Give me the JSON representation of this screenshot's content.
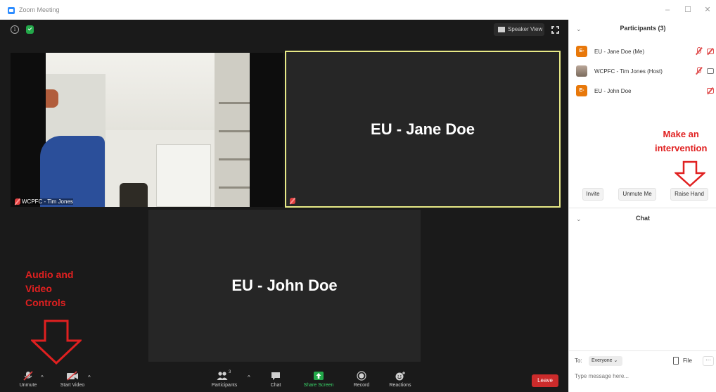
{
  "window": {
    "title": "Zoom Meeting",
    "minimize_icon": "–",
    "maximize_icon": "☐",
    "close_icon": "✕"
  },
  "video": {
    "speaker_view_label": "Speaker View",
    "tiles": {
      "tim": {
        "label": "WCPFC - Tim Jones"
      },
      "jane": {
        "name": "EU - Jane Doe"
      },
      "john": {
        "name": "EU - John Doe"
      }
    }
  },
  "annotations": {
    "controls_line1": "Audio and",
    "controls_line2": "Video",
    "controls_line3": "Controls",
    "intervention_line1": "Make an",
    "intervention_line2": "intervention",
    "color": "#e02020"
  },
  "toolbar": {
    "unmute": "Unmute",
    "start_video": "Start Video",
    "participants": "Participants",
    "participants_count": "3",
    "chat": "Chat",
    "share_screen": "Share Screen",
    "record": "Record",
    "reactions": "Reactions",
    "leave": "Leave",
    "caret": "^"
  },
  "panel": {
    "participants_title": "Participants (3)",
    "collapse_icon": "⌄",
    "participants": [
      {
        "initials": "E-",
        "name": "EU - Jane Doe (Me)"
      },
      {
        "initials": "",
        "name": "WCPFC - Tim Jones (Host)"
      },
      {
        "initials": "E-",
        "name": "EU - John Doe"
      }
    ],
    "invite": "Invite",
    "unmute_me": "Unmute Me",
    "raise_hand": "Raise Hand",
    "chat_title": "Chat",
    "to_label": "To:",
    "recipient": "Everyone ⌄",
    "file": "File",
    "more": "···",
    "message_placeholder": "Type message here..."
  },
  "colors": {
    "accent": "#2d8cff",
    "leave": "#cc2b2b",
    "share": "#23a94a",
    "active_speaker_border": "#e7e986",
    "avatar": "#e8780a"
  }
}
